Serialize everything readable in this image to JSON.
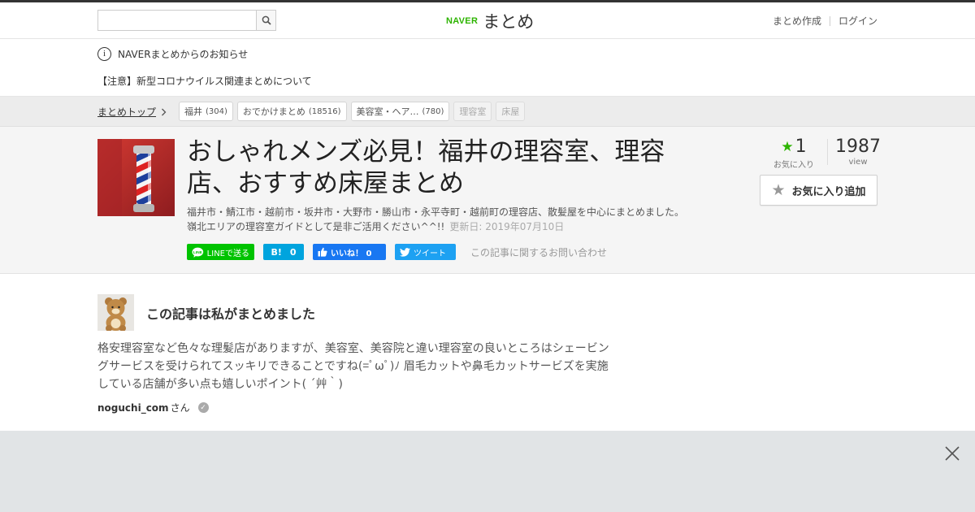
{
  "header": {
    "search": {
      "placeholder": "",
      "value": ""
    },
    "logo": {
      "brand": "NAVER",
      "service": "まとめ"
    },
    "links": {
      "create": "まとめ作成",
      "login": "ログイン"
    }
  },
  "notice": {
    "heading": "NAVERまとめからのお知らせ",
    "link": "【注意】新型コロナウイルス関連まとめについて"
  },
  "breadcrumb": {
    "top": "まとめトップ",
    "tags": [
      {
        "label": "福井",
        "count": "(304)",
        "disabled": false
      },
      {
        "label": "おでかけまとめ",
        "count": "(18516)",
        "disabled": false
      },
      {
        "label": "美容室・ヘア…",
        "count": "(780)",
        "disabled": false
      },
      {
        "label": "理容室",
        "count": "",
        "disabled": true
      },
      {
        "label": "床屋",
        "count": "",
        "disabled": true
      }
    ]
  },
  "article": {
    "title": "おしゃれメンズ必見！福井の理容室、理容店、おすすめ床屋まとめ",
    "description_line1": "福井市・鯖江市・越前市・坂井市・大野市・勝山市・永平寺町・越前町の理容店、散髪屋を中心にまとめました。",
    "description_line2": "嶺北エリアの理容室ガイドとして是非ご活用ください^^!!",
    "updated": "更新日: 2019年07月10日",
    "share": {
      "line": "LINEで送る",
      "hatena": "0",
      "hatena_mark": "B!",
      "facebook": "いいね！ 0",
      "twitter": "ツイート"
    },
    "contact": "この記事に関するお問い合わせ",
    "favorites": {
      "count": "1",
      "label": "お気に入り"
    },
    "views": {
      "count": "1987",
      "label": "view"
    },
    "fav_button": "お気に入り追加"
  },
  "author": {
    "heading": "この記事は私がまとめました",
    "description": "格安理容室など色々な理髪店がありますが、美容室、美容院と違い理容室の良いところはシェービングサービスを受けられてスッキリできることですね(=ﾟωﾟ)ﾉ 眉毛カットや鼻毛カットサービズを実施している店舗が多い点も嬉しいポイント( ´艸｀)",
    "name": "noguchi_com",
    "suffix": "さん"
  },
  "colors": {
    "accent": "#2db400",
    "line": "#00c300",
    "hatena": "#00a4de",
    "facebook": "#1877f2",
    "twitter": "#1da1f2"
  }
}
